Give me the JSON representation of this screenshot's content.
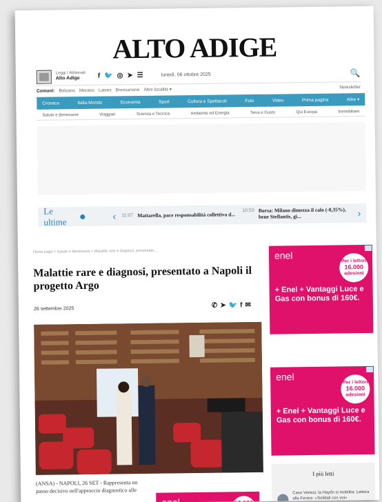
{
  "masthead": {
    "title": "ALTO ADIGE"
  },
  "utility": {
    "login_small": "Leggi / Abbonati",
    "login_brand": "Alto Adige",
    "social_icons": [
      "facebook-icon",
      "twitter-icon",
      "instagram-icon",
      "telegram-icon",
      "rss-icon"
    ],
    "date": "lunedì, 06 ottobre 2025",
    "search_icon": "search-icon"
  },
  "comuni": {
    "label": "Comuni:",
    "items": [
      "Bolzano",
      "Merano",
      "Laives",
      "Bressanone",
      "Altre località ▾"
    ],
    "newsletter": "Newsletter"
  },
  "nav": {
    "items": [
      "Cronaca",
      "Italia-Mondo",
      "Economia",
      "Sport",
      "Cultura e Spettacoli",
      "Foto",
      "Video",
      "Prima pagina",
      "Altre ▾"
    ]
  },
  "subnav": {
    "items": [
      "Salute e Benessere",
      "Viaggiari",
      "Scienza e Tecnica",
      "Ambiente ed Energia",
      "Terra e Gusto",
      "Qui Europa",
      "Immobiliare"
    ]
  },
  "ultime": {
    "title": "Le ultime",
    "news": [
      {
        "time": "11:07",
        "text": "Mattarella, pace responsabilità collettiva d..."
      },
      {
        "time": "10:53",
        "text": "Borsa: Milano dimezza il calo (-0,35%), bene Stellantis, gi..."
      }
    ]
  },
  "article": {
    "breadcrumb": "Home page  >  Salute e Benessere  >  Malattie rare e diagnosi, presentato...",
    "headline": "Malattie rare e diagnosi, presentato a Napoli il progetto Argo",
    "date": "26 settembre 2025",
    "share_icons": [
      "whatsapp-icon",
      "telegram-icon",
      "twitter-icon",
      "facebook-icon",
      "email-icon"
    ],
    "body": "(ANSA) - NAPOLI, 26 SET - Rappresenta un passo decisivo nell'approccio diagnostico alle"
  },
  "ads": {
    "logo": "enel",
    "badge_top": "Per i lettori",
    "badge_num": "16.000",
    "badge_bottom": "adesioni",
    "text": "+ Enel + Vantaggi Luce e Gas con bonus di 160€.",
    "brand_color": "#e0116b"
  },
  "piu_letti": {
    "title": "I più letti",
    "item": "Caso Venezi, la Haydn si mobilita: Lettera alla Fenice: «Solidali con voi»"
  },
  "colors": {
    "nav": "#3a9bbf",
    "accent": "#2f7fb3"
  }
}
